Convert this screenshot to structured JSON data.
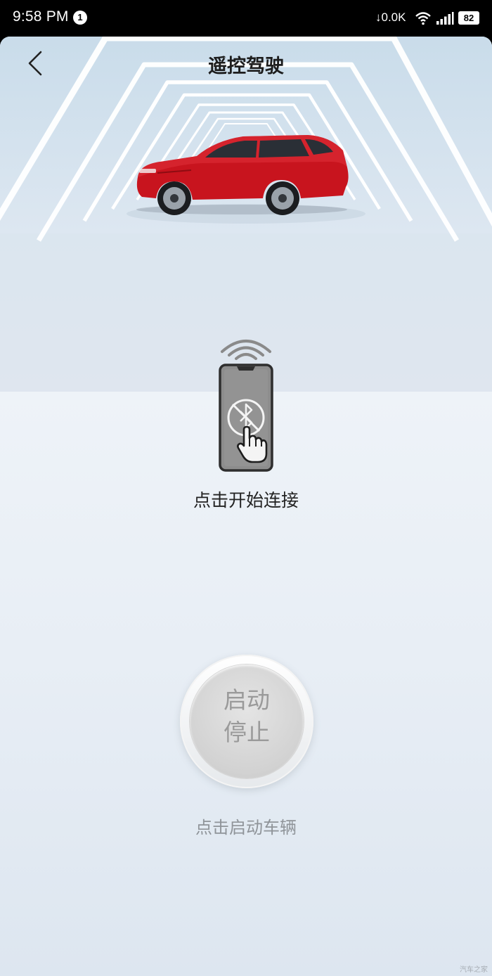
{
  "status_bar": {
    "time": "9:58 PM",
    "notification_count": "1",
    "net_speed": "↓0.0K",
    "battery": "82"
  },
  "header": {
    "title": "遥控驾驶"
  },
  "connect": {
    "label": "点击开始连接"
  },
  "start_button": {
    "line1": "启动",
    "line2": "停止",
    "hint": "点击启动车辆"
  },
  "watermark": "汽车之家",
  "icons": {
    "back": "chevron-left-icon",
    "phone": "phone-bluetooth-icon",
    "signal_waves": "wireless-waves-icon"
  },
  "colors": {
    "car": "#c8141e",
    "title": "#1d1d1d",
    "hint": "#8f9499"
  }
}
